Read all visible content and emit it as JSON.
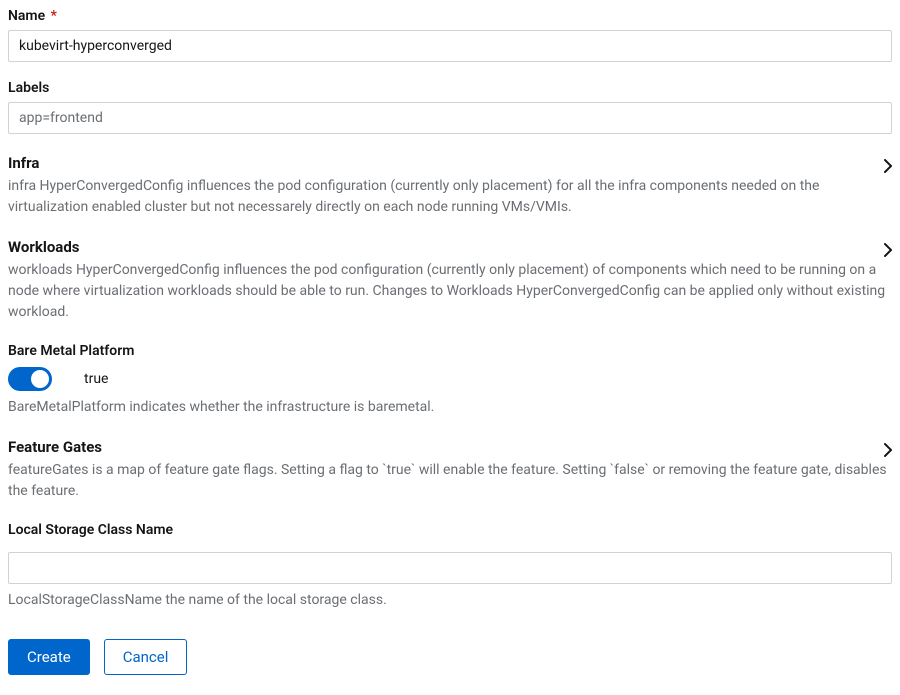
{
  "name": {
    "label": "Name",
    "value": "kubevirt-hyperconverged"
  },
  "labels": {
    "label": "Labels",
    "placeholder": "app=frontend",
    "value": ""
  },
  "infra": {
    "title": "Infra",
    "desc": "infra HyperConvergedConfig influences the pod configuration (currently only placement) for all the infra components needed on the virtualization enabled cluster but not necessarely directly on each node running VMs/VMIs."
  },
  "workloads": {
    "title": "Workloads",
    "desc": "workloads HyperConvergedConfig influences the pod configuration (currently only placement) of components which need to be running on a node where virtualization workloads should be able to run. Changes to Workloads HyperConvergedConfig can be applied only without existing workload."
  },
  "bareMetal": {
    "title": "Bare Metal Platform",
    "value": "true",
    "desc": "BareMetalPlatform indicates whether the infrastructure is baremetal."
  },
  "featureGates": {
    "title": "Feature Gates",
    "desc": "featureGates is a map of feature gate flags. Setting a flag to `true` will enable the feature. Setting `false` or removing the feature gate, disables the feature."
  },
  "localStorage": {
    "title": "Local Storage Class Name",
    "value": "",
    "desc": "LocalStorageClassName the name of the local storage class."
  },
  "buttons": {
    "create": "Create",
    "cancel": "Cancel"
  }
}
